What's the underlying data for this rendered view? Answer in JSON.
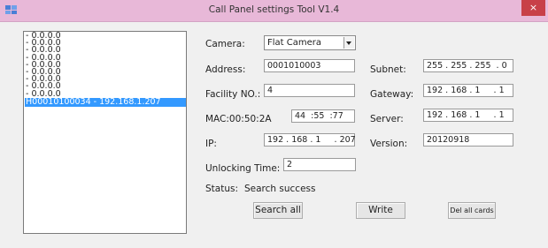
{
  "window": {
    "title": "Call Panel settings Tool V1.4",
    "close_glyph": "×",
    "icon": "app-icon"
  },
  "device_list": {
    "items": [
      "- 0.0.0.0",
      "- 0.0.0.0",
      "- 0.0.0.0",
      "- 0.0.0.0",
      "- 0.0.0.0",
      "- 0.0.0.0",
      "- 0.0.0.0",
      "- 0.0.0.0",
      "- 0.0.0.0",
      "H00010100034 - 192.168.1.207"
    ],
    "selected_index": 9
  },
  "form": {
    "camera_label": "Camera:",
    "camera_value": "Flat Camera",
    "address_label": "Address:",
    "address_value": "0001010003",
    "facility_label": "Facility NO.:",
    "facility_value": "4",
    "mac_label": "MAC:00:50:2A",
    "mac_value": "44  :55  :77",
    "ip_label": "IP:",
    "ip_value": "192 . 168 . 1     . 207",
    "subnet_label": "Subnet:",
    "subnet_value": "255 . 255 . 255  . 0",
    "gateway_label": "Gateway:",
    "gateway_value": "192 . 168 . 1     . 1",
    "server_label": "Server:",
    "server_value": "192 . 168 . 1     . 1",
    "version_label": "Version:",
    "version_value": "20120918",
    "unlocking_label": "Unlocking  Time:",
    "unlocking_value": "2",
    "status_label": "Status:",
    "status_value": "Search success"
  },
  "buttons": {
    "search_all": "Search all",
    "write": "Write",
    "del_all_cards": "Del all cards"
  },
  "colors": {
    "titlebar": "#e8b8d8",
    "close": "#c84048",
    "selection": "#3399ff"
  }
}
